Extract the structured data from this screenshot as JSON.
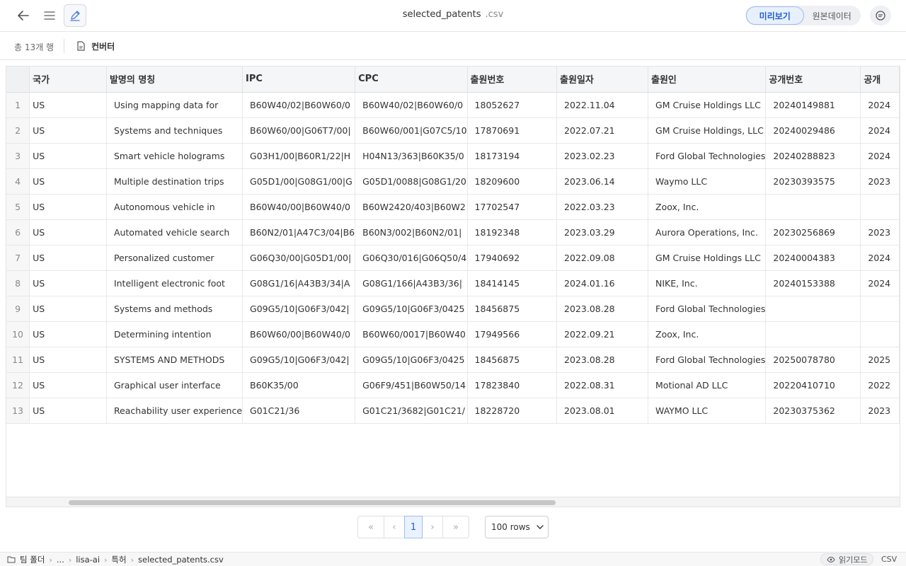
{
  "header": {
    "filename": "selected_patents",
    "extension": ".csv",
    "view_modes": [
      "미리보기",
      "원본데이터"
    ],
    "active_view": "미리보기"
  },
  "toolbar": {
    "row_count": "총 13개 행",
    "converter_label": "컨버터"
  },
  "table": {
    "columns": [
      "국가",
      "발명의 명칭",
      "IPC",
      "CPC",
      "출원번호",
      "출원일자",
      "출원인",
      "공개번호",
      "공개"
    ],
    "rows": [
      [
        "1",
        "US",
        "Using mapping data for",
        "B60W40/02|B60W60/0",
        "B60W40/02|B60W60/0",
        "18052627",
        "2022.11.04",
        "GM Cruise Holdings LLC",
        "20240149881",
        "2024"
      ],
      [
        "2",
        "US",
        "Systems and techniques",
        "B60W60/00|G06T7/00|",
        "B60W60/001|G07C5/10",
        "17870691",
        "2022.07.21",
        "GM Cruise Holdings, LLC",
        "20240029486",
        "2024"
      ],
      [
        "3",
        "US",
        "Smart vehicle holograms",
        "G03H1/00|B60R1/22|H",
        "H04N13/363|B60K35/0",
        "18173194",
        "2023.02.23",
        "Ford Global Technologies",
        "20240288823",
        "2024"
      ],
      [
        "4",
        "US",
        "Multiple destination trips",
        "G05D1/00|G08G1/00|G",
        "G05D1/0088|G08G1/20",
        "18209600",
        "2023.06.14",
        "Waymo LLC",
        "20230393575",
        "2023"
      ],
      [
        "5",
        "US",
        "Autonomous vehicle in",
        "B60W40/00|B60W40/0",
        "B60W2420/403|B60W2",
        "17702547",
        "2022.03.23",
        "Zoox, Inc.",
        "",
        ""
      ],
      [
        "6",
        "US",
        "Automated vehicle search",
        "B60N2/01|A47C3/04|B6",
        "B60N3/002|B60N2/01|",
        "18192348",
        "2023.03.29",
        "Aurora Operations, Inc.",
        "20230256869",
        "2023"
      ],
      [
        "7",
        "US",
        "Personalized customer",
        "G06Q30/00|G05D1/00|",
        "G06Q30/016|G06Q50/4",
        "17940692",
        "2022.09.08",
        "GM Cruise Holdings LLC",
        "20240004383",
        "2024"
      ],
      [
        "8",
        "US",
        "Intelligent electronic foot",
        "G08G1/16|A43B3/34|A",
        "G08G1/166|A43B3/36|",
        "18414145",
        "2024.01.16",
        "NIKE, Inc.",
        "20240153388",
        "2024"
      ],
      [
        "9",
        "US",
        "Systems and methods",
        "G09G5/10|G06F3/042|",
        "G09G5/10|G06F3/0425",
        "18456875",
        "2023.08.28",
        "Ford Global Technologies",
        "",
        ""
      ],
      [
        "10",
        "US",
        "Determining intention",
        "B60W60/00|B60W40/0",
        "B60W60/0017|B60W40",
        "17949566",
        "2022.09.21",
        "Zoox, Inc.",
        "",
        ""
      ],
      [
        "11",
        "US",
        "SYSTEMS AND METHODS",
        "G09G5/10|G06F3/042|",
        "G09G5/10|G06F3/0425",
        "18456875",
        "2023.08.28",
        "Ford Global Technologies",
        "20250078780",
        "2025"
      ],
      [
        "12",
        "US",
        "Graphical user interface",
        "B60K35/00",
        "G06F9/451|B60W50/14",
        "17823840",
        "2022.08.31",
        "Motional AD LLC",
        "20220410710",
        "2022"
      ],
      [
        "13",
        "US",
        "Reachability user experience",
        "G01C21/36",
        "G01C21/3682|G01C21/",
        "18228720",
        "2023.08.01",
        "WAYMO LLC",
        "20230375362",
        "2023"
      ]
    ]
  },
  "pagination": {
    "current_page": "1",
    "rows_per_page": "100 rows"
  },
  "status": {
    "breadcrumbs": [
      "팀 폴더",
      "...",
      "lisa-ai",
      "특허",
      "selected_patents.csv"
    ],
    "read_mode": "읽기모드",
    "file_type": "CSV"
  },
  "colors": {
    "accent": "#1f5fd6",
    "accent_bg": "#e8f0fe",
    "header_bg": "#f5f6f8"
  }
}
